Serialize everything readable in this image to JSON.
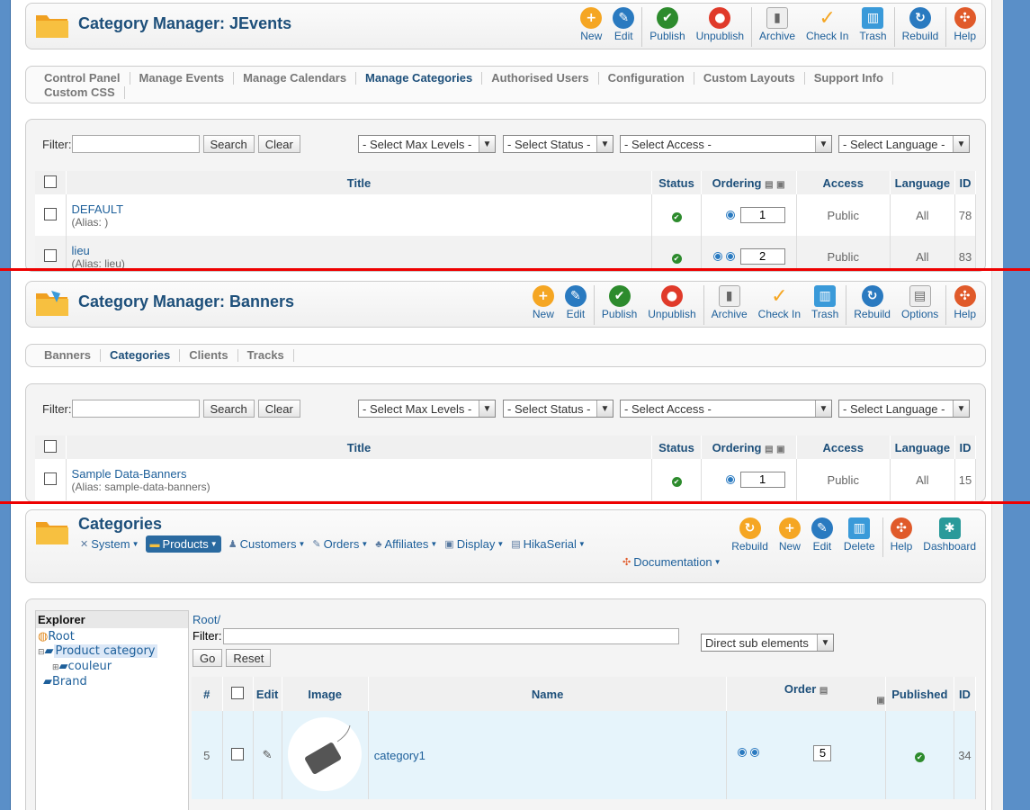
{
  "jevents": {
    "title": "Category Manager: JEvents",
    "toolbar": [
      {
        "label": "New",
        "icon": "new-icon",
        "color": "#f5a623"
      },
      {
        "label": "Edit",
        "icon": "edit-icon",
        "color": "#2a7ac0"
      },
      {
        "label": "Publish",
        "icon": "publish-icon",
        "color": "#2d8b2d"
      },
      {
        "label": "Unpublish",
        "icon": "unpublish-icon",
        "color": "#e03a2a"
      },
      {
        "label": "Archive",
        "icon": "archive-icon",
        "color": "#999"
      },
      {
        "label": "Check In",
        "icon": "checkin-icon",
        "color": "#f5a623"
      },
      {
        "label": "Trash",
        "icon": "trash-icon",
        "color": "#3a9ad9"
      },
      {
        "label": "Rebuild",
        "icon": "rebuild-icon",
        "color": "#2a7ac0"
      },
      {
        "label": "Help",
        "icon": "help-icon",
        "color": "#e05a2a"
      }
    ],
    "tabs": [
      "Control Panel",
      "Manage Events",
      "Manage Calendars",
      "Manage Categories",
      "Authorised Users",
      "Configuration",
      "Custom Layouts",
      "Support Info",
      "Custom CSS"
    ],
    "active_tab": "Manage Categories",
    "filter_label": "Filter:",
    "search": "Search",
    "clear": "Clear",
    "selects": [
      "- Select Max Levels -",
      "- Select Status -",
      "- Select Access -",
      "- Select Language -"
    ],
    "columns": [
      "Title",
      "Status",
      "Ordering",
      "Access",
      "Language",
      "ID"
    ],
    "rows": [
      {
        "title": "DEFAULT",
        "alias": "(Alias: )",
        "order": "1",
        "access": "Public",
        "language": "All",
        "id": "78"
      },
      {
        "title": "lieu",
        "alias": "(Alias: lieu)",
        "order": "2",
        "access": "Public",
        "language": "All",
        "id": "83"
      }
    ]
  },
  "banners": {
    "title": "Category Manager: Banners",
    "toolbar": [
      {
        "label": "New",
        "icon": "new-icon",
        "color": "#f5a623"
      },
      {
        "label": "Edit",
        "icon": "edit-icon",
        "color": "#2a7ac0"
      },
      {
        "label": "Publish",
        "icon": "publish-icon",
        "color": "#2d8b2d"
      },
      {
        "label": "Unpublish",
        "icon": "unpublish-icon",
        "color": "#e03a2a"
      },
      {
        "label": "Archive",
        "icon": "archive-icon",
        "color": "#999"
      },
      {
        "label": "Check In",
        "icon": "checkin-icon",
        "color": "#f5a623"
      },
      {
        "label": "Trash",
        "icon": "trash-icon",
        "color": "#3a9ad9"
      },
      {
        "label": "Rebuild",
        "icon": "rebuild-icon",
        "color": "#2a7ac0"
      },
      {
        "label": "Options",
        "icon": "options-icon",
        "color": "#aaa"
      },
      {
        "label": "Help",
        "icon": "help-icon",
        "color": "#e05a2a"
      }
    ],
    "tabs": [
      "Banners",
      "Categories",
      "Clients",
      "Tracks"
    ],
    "active_tab": "Categories",
    "filter_label": "Filter:",
    "search": "Search",
    "clear": "Clear",
    "selects": [
      "- Select Max Levels -",
      "- Select Status -",
      "- Select Access -",
      "- Select Language -"
    ],
    "columns": [
      "Title",
      "Status",
      "Ordering",
      "Access",
      "Language",
      "ID"
    ],
    "rows": [
      {
        "title": "Sample Data-Banners",
        "alias": "(Alias: sample-data-banners)",
        "order": "1",
        "access": "Public",
        "language": "All",
        "id": "15"
      }
    ]
  },
  "hika": {
    "title": "Categories",
    "menu": [
      {
        "label": "System",
        "icon": "wrench-icon"
      },
      {
        "label": "Products",
        "icon": "products-icon",
        "active": true
      },
      {
        "label": "Customers",
        "icon": "customers-icon"
      },
      {
        "label": "Orders",
        "icon": "orders-icon"
      },
      {
        "label": "Affiliates",
        "icon": "affiliates-icon"
      },
      {
        "label": "Display",
        "icon": "display-icon"
      },
      {
        "label": "HikaSerial",
        "icon": "hikaserial-icon"
      }
    ],
    "documentation": "Documentation",
    "toolbar": [
      {
        "label": "Rebuild",
        "icon": "rebuild-icon",
        "color": "#f5a623"
      },
      {
        "label": "New",
        "icon": "new-icon",
        "color": "#f5a623"
      },
      {
        "label": "Edit",
        "icon": "edit-icon",
        "color": "#2a7ac0"
      },
      {
        "label": "Delete",
        "icon": "delete-icon",
        "color": "#3a9ad9"
      },
      {
        "label": "Help",
        "icon": "help-icon",
        "color": "#e05a2a"
      },
      {
        "label": "Dashboard",
        "icon": "dashboard-icon",
        "color": "#2a9a9a"
      }
    ],
    "explorer": "Explorer",
    "tree": {
      "root": "Root",
      "product_category": "Product category",
      "couleur": "couleur",
      "brand": "Brand"
    },
    "path": "Root/",
    "filter_label": "Filter:",
    "scope": "Direct sub elements",
    "go": "Go",
    "reset": "Reset",
    "columns": [
      "#",
      "Edit",
      "Image",
      "Name",
      "Order",
      "Published",
      "ID"
    ],
    "rows": [
      {
        "num": "5",
        "name": "category1",
        "order": "5",
        "id": "34"
      }
    ]
  }
}
